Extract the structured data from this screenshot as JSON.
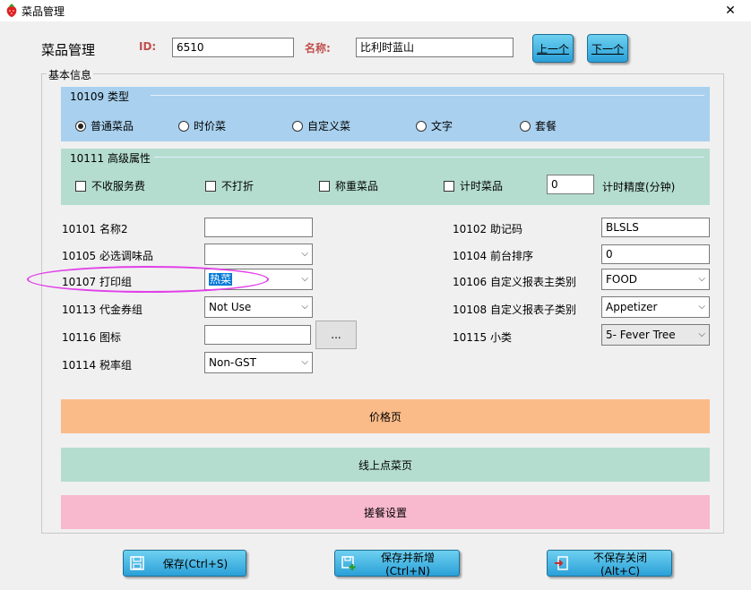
{
  "window": {
    "title": "菜品管理",
    "close_glyph": "✕"
  },
  "header": {
    "title": "菜品管理",
    "id_label": "ID:",
    "id_value": "6510",
    "name_label": "名称:",
    "name_value": "比利时蓝山",
    "prev_label": "上一个",
    "next_label": "下一个"
  },
  "basic_group": {
    "legend": "基本信息"
  },
  "type_panel": {
    "title": "10109 类型",
    "options": [
      "普通菜品",
      "时价菜",
      "自定义菜",
      "文字",
      "套餐"
    ],
    "selected_index": 0
  },
  "advanced_panel": {
    "title": "10111 高级属性",
    "checkboxes": [
      "不收服务费",
      "不打折",
      "称重菜品",
      "计时菜品"
    ],
    "timer_value": "0",
    "timer_unit_label": "计时精度(分钟)"
  },
  "fields": {
    "name2_label": "10101 名称2",
    "name2_value": "",
    "seasoning_label": "10105 必选调味品",
    "seasoning_value": "",
    "print_group_label": "10107 打印组",
    "print_group_value": "热菜",
    "voucher_label": "10113 代金券组",
    "voucher_value": "Not Use",
    "icon_label": "10116 图标",
    "icon_value": "",
    "browse_label": "...",
    "tax_label": "10114 税率组",
    "tax_value": "Non-GST",
    "mnemonic_label": "10102 助记码",
    "mnemonic_value": "BLSLS",
    "sort_label": "10104 前台排序",
    "sort_value": "0",
    "main_cat_label": "10106 自定义报表主类别",
    "main_cat_value": "FOOD",
    "sub_cat_label": "10108 自定义报表子类别",
    "sub_cat_value": "Appetizer",
    "subclass_label": "10115 小类",
    "subclass_value": "5- Fever Tree"
  },
  "bars": {
    "price": "价格页",
    "online": "线上点菜页",
    "meal": "搓餐设置"
  },
  "footer": {
    "save_label": "保存(Ctrl+S)",
    "save_new_label": "保存并新增(Ctrl+N)",
    "close_label": "不保存关闭(Alt+C)"
  },
  "colors": {
    "type_panel_bg": "#a9d1ef",
    "advanced_panel_bg": "#b4ddd0",
    "price_bar_bg": "#fbbb88",
    "online_bar_bg": "#b4ddd0",
    "meal_bar_bg": "#f8b8cd",
    "id_label_color": "#c0504d",
    "highlight": "#e040e8"
  },
  "icons": {
    "app": "strawberry-icon",
    "save": "floppy-icon",
    "save_new": "floppy-plus-icon",
    "close": "exit-icon",
    "dropdown": "chevron-down-icon"
  }
}
